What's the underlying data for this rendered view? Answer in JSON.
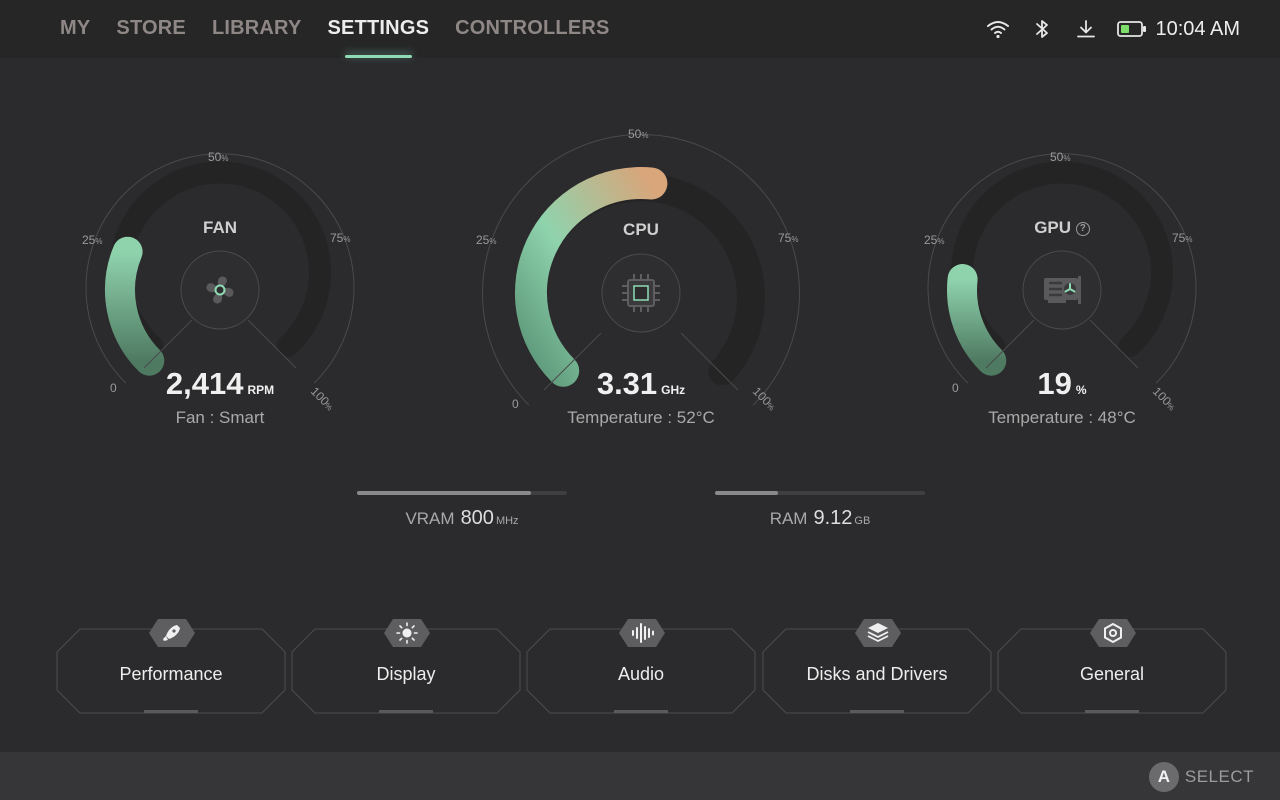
{
  "nav": {
    "tabs": [
      {
        "label": "MY"
      },
      {
        "label": "STORE"
      },
      {
        "label": "LIBRARY"
      },
      {
        "label": "SETTINGS",
        "active": true
      },
      {
        "label": "CONTROLLERS"
      }
    ]
  },
  "status": {
    "icons": [
      "wifi-icon",
      "bluetooth-icon",
      "download-icon",
      "battery-icon"
    ],
    "time": "10:04 AM"
  },
  "gauges": {
    "fan": {
      "title": "FAN",
      "value": "2,414",
      "unit": "RPM",
      "sub": "Fan : Smart",
      "level": 0.25,
      "icon": "fan-icon"
    },
    "cpu": {
      "title": "CPU",
      "value": "3.31",
      "unit": "GHz",
      "sub": "Temperature : 52°C",
      "level": 0.52,
      "icon": "cpu-chip-icon"
    },
    "gpu": {
      "title": "GPU",
      "value": "19",
      "unit": "%",
      "sub": "Temperature : 48°C",
      "level": 0.19,
      "icon": "graphics-card-icon",
      "help_icon": "help-icon"
    },
    "ticks": {
      "t0": "0",
      "t25": "25",
      "t50": "50",
      "t75": "75",
      "t100": "100",
      "pct": "%"
    }
  },
  "memory": {
    "vram": {
      "label": "VRAM",
      "value": "800",
      "unit": "MHz",
      "level": 0.83
    },
    "ram": {
      "label": "RAM",
      "value": "9.12",
      "unit": "GB",
      "level": 0.3
    }
  },
  "categories": [
    {
      "label": "Performance",
      "icon": "rocket-icon"
    },
    {
      "label": "Display",
      "icon": "brightness-icon"
    },
    {
      "label": "Audio",
      "icon": "audio-wave-icon"
    },
    {
      "label": "Disks and Drivers",
      "icon": "layers-icon"
    },
    {
      "label": "General",
      "icon": "settings-hex-icon"
    }
  ],
  "footer": {
    "button": "A",
    "action": "SELECT"
  },
  "colors": {
    "accent": "#8fdcb4",
    "gauge_start": "#6fb98f",
    "gauge_end": "#d4a47c",
    "background": "#2b2b2d"
  }
}
